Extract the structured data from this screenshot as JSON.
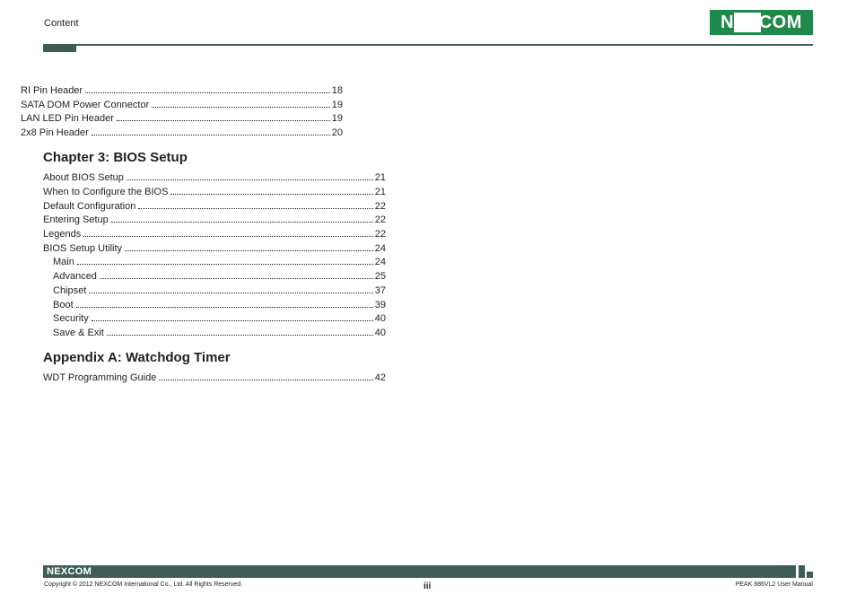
{
  "header": {
    "section_label": "Content",
    "logo_text": "NEXCOM"
  },
  "toc_top": [
    {
      "title": "RI Pin Header",
      "page": "18"
    },
    {
      "title": "SATA DOM Power Connector",
      "page": "19"
    },
    {
      "title": "LAN LED Pin Header",
      "page": "19"
    },
    {
      "title": "2x8 Pin Header",
      "page": "20"
    }
  ],
  "chapter3": {
    "heading": "Chapter 3: BIOS Setup",
    "entries": [
      {
        "title": "About BIOS Setup",
        "page": "21"
      },
      {
        "title": "When to Configure the BIOS",
        "page": "21"
      },
      {
        "title": "Default Configuration",
        "page": "22"
      },
      {
        "title": "Entering Setup",
        "page": "22"
      },
      {
        "title": "Legends",
        "page": "22"
      },
      {
        "title": "BIOS Setup Utility",
        "page": "24"
      }
    ],
    "sub_entries": [
      {
        "title": "Main",
        "page": "24"
      },
      {
        "title": "Advanced",
        "page": "25"
      },
      {
        "title": "Chipset",
        "page": "37"
      },
      {
        "title": "Boot",
        "page": "39"
      },
      {
        "title": "Security",
        "page": "40"
      },
      {
        "title": "Save & Exit",
        "page": "40"
      }
    ]
  },
  "appendixA": {
    "heading": "Appendix A: Watchdog Timer",
    "entries": [
      {
        "title": "WDT Programming Guide",
        "page": "42"
      }
    ]
  },
  "footer": {
    "logo_text": "NEXCOM",
    "copyright": "Copyright © 2012 NEXCOM International Co., Ltd. All Rights Reserved.",
    "page_number": "iii",
    "manual_name": "PEAK 886VL2 User Manual"
  },
  "colors": {
    "accent": "#3f5d57",
    "logo_green": "#1f8a4c",
    "text": "#231f20"
  }
}
